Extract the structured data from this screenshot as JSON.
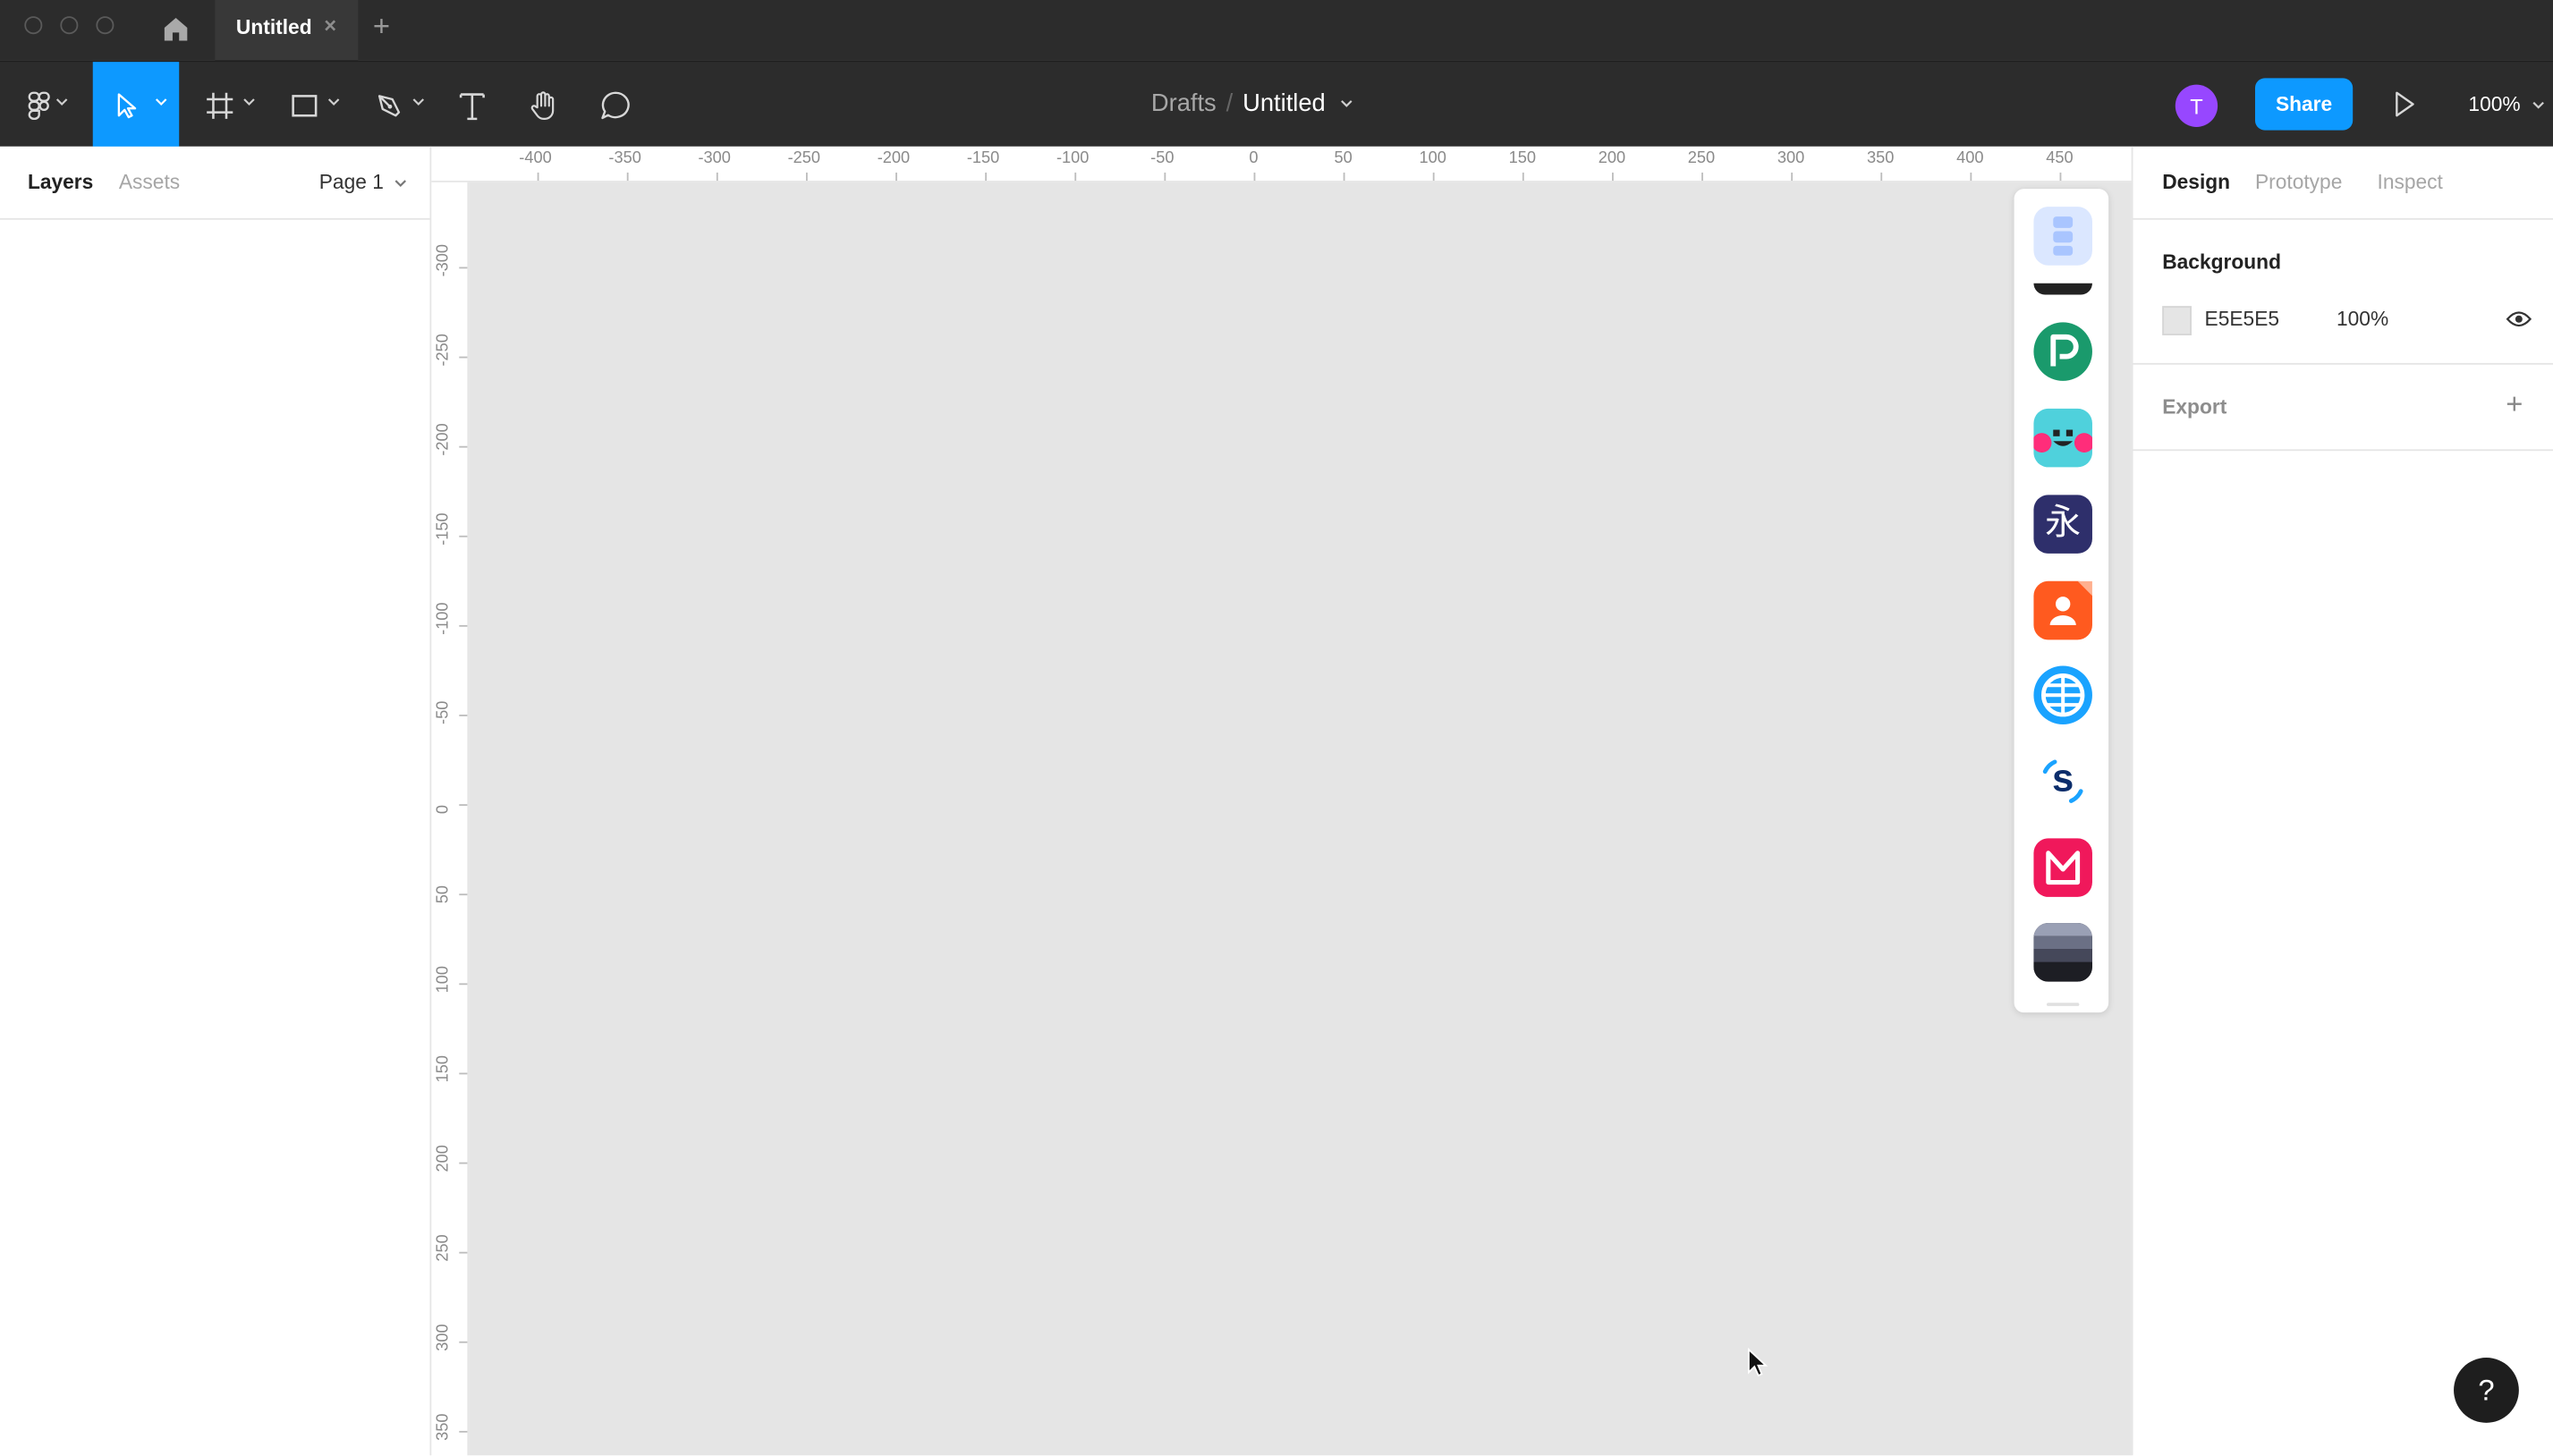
{
  "window": {
    "tab_title": "Untitled",
    "tab_close": "×",
    "new_tab": "+"
  },
  "toolbar": {
    "breadcrumb_parent": "Drafts",
    "breadcrumb_sep": "/",
    "file_name": "Untitled",
    "avatar_initial": "T",
    "share_label": "Share",
    "zoom_level": "100%"
  },
  "left_panel": {
    "tabs": [
      "Layers",
      "Assets"
    ],
    "page_selector": "Page 1"
  },
  "rulers": {
    "top_ticks": [
      "-400",
      "-350",
      "-300",
      "-250",
      "-200",
      "-150",
      "-100",
      "-50",
      "0",
      "50",
      "100",
      "150",
      "200",
      "250",
      "300",
      "350",
      "400",
      "450"
    ],
    "left_ticks": [
      "-300",
      "-250",
      "-200",
      "-150",
      "-100",
      "-50",
      "0",
      "50",
      "100",
      "150",
      "200",
      "250",
      "300",
      "350"
    ]
  },
  "plugins": [
    {
      "name": "plugin-layout-icon",
      "color": "#dbe7ff"
    },
    {
      "name": "plugin-p-icon",
      "color": "#1a9a6c"
    },
    {
      "name": "plugin-face-icon",
      "color": "#4fd1dc"
    },
    {
      "name": "plugin-kanji-icon",
      "color": "#2e2f6b"
    },
    {
      "name": "plugin-avatar-icon",
      "color": "#ff5a1f"
    },
    {
      "name": "plugin-globe-icon",
      "color": "#1aa3ff"
    },
    {
      "name": "plugin-s-icon",
      "color": "#ffffff"
    },
    {
      "name": "plugin-m-icon",
      "color": "#f0185b"
    },
    {
      "name": "plugin-stack-icon",
      "color": "#2b2b33"
    }
  ],
  "plugin_glyphs": {
    "kanji": "永",
    "s_letter": "s"
  },
  "right_panel": {
    "tabs": [
      "Design",
      "Prototype",
      "Inspect"
    ],
    "background_title": "Background",
    "background_hex": "E5E5E5",
    "background_opacity": "100%",
    "export_title": "Export",
    "export_add": "+"
  },
  "help_label": "?",
  "colors": {
    "accent": "#0d99ff",
    "toolbar": "#2c2c2c",
    "canvas": "#e5e5e5",
    "avatar": "#9747ff"
  }
}
